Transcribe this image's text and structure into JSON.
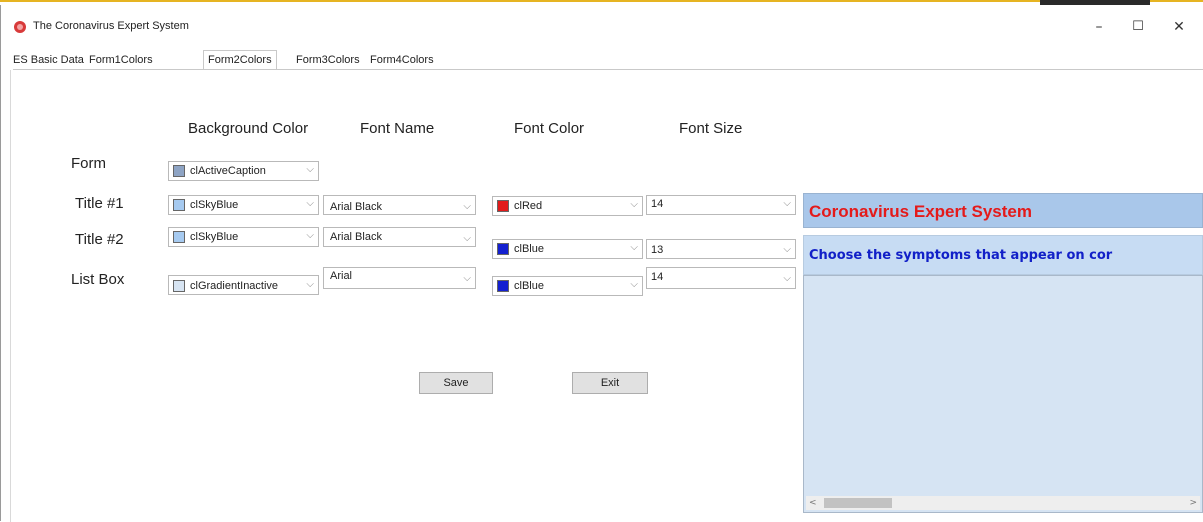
{
  "window": {
    "title": "The Coronavirus Expert System",
    "minimize": "–",
    "maximize": "☐",
    "close": "✕"
  },
  "tabs": [
    {
      "label": "ES Basic Data"
    },
    {
      "label": "Form1Colors"
    },
    {
      "label": "Form2Colors",
      "active": true
    },
    {
      "label": "Form3Colors"
    },
    {
      "label": "Form4Colors"
    }
  ],
  "columns": {
    "background_color": "Background Color",
    "font_name": "Font Name",
    "font_color": "Font Color",
    "font_size": "Font Size"
  },
  "rows": [
    {
      "label": "Form",
      "background": "clActiveCaption",
      "background_swatch": "#8ea4c4"
    },
    {
      "label": "Title #1",
      "background": "clSkyBlue",
      "background_swatch": "#a6caf0",
      "font_name": "Arial Black",
      "font_color": "clRed",
      "font_color_swatch": "#e11b1b",
      "font_size": "14"
    },
    {
      "label": "Title #2",
      "background": "clSkyBlue",
      "background_swatch": "#a6caf0",
      "font_name": "Arial Black",
      "font_color": "clBlue",
      "font_color_swatch": "#1420d0",
      "font_size": "13"
    },
    {
      "label": "List Box",
      "background": "clGradientInactive",
      "background_swatch": "#d7e4f2",
      "font_name": "Arial",
      "font_color": "clBlue",
      "font_color_swatch": "#1420d0",
      "font_size": "14"
    }
  ],
  "combo_arrow": "⌵",
  "buttons": {
    "save": "Save",
    "exit": "Exit"
  },
  "preview": {
    "title": "Coronavirus Expert System",
    "subtitle": "Choose the symptoms that appear on cor",
    "scroll_left": "<",
    "scroll_right": ">"
  }
}
